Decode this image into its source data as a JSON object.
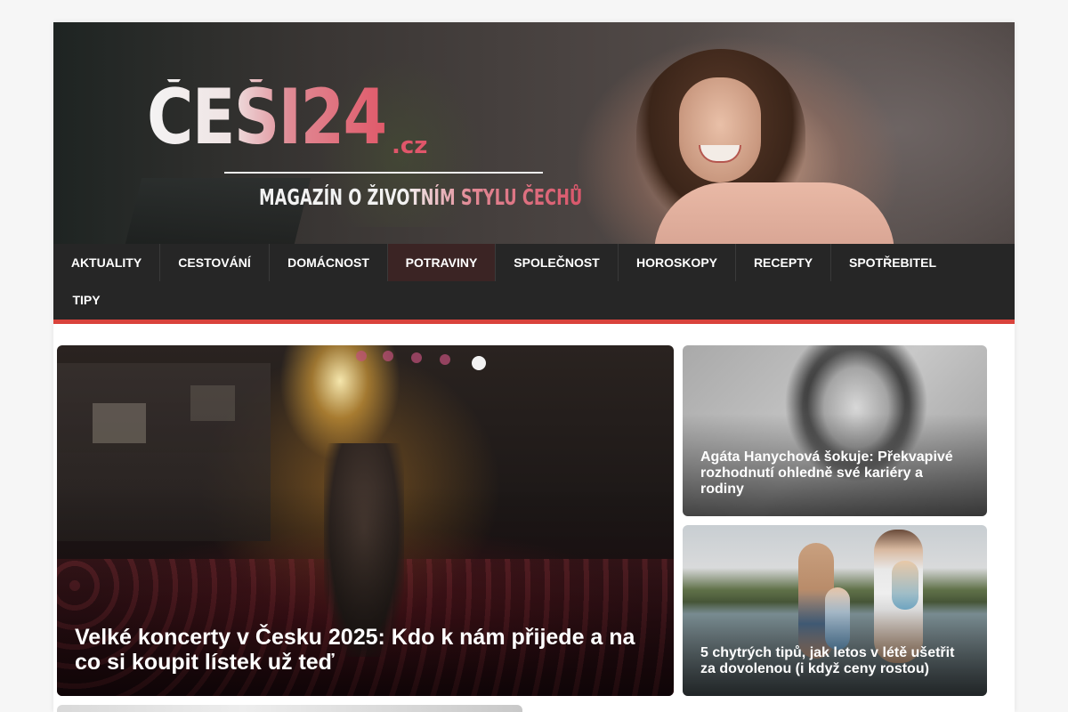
{
  "header": {
    "logo_main": "ČEŠI24",
    "logo_tld": ".cz",
    "tagline": "MAGAZÍN O ŽIVOTNÍM STYLU ČECHŮ"
  },
  "nav": {
    "items": [
      {
        "label": "AKTUALITY"
      },
      {
        "label": "CESTOVÁNÍ"
      },
      {
        "label": "DOMÁCNOST"
      },
      {
        "label": "POTRAVINY"
      },
      {
        "label": "SPOLEČNOST"
      },
      {
        "label": "HOROSKOPY"
      },
      {
        "label": "RECEPTY"
      },
      {
        "label": "SPOTŘEBITEL"
      },
      {
        "label": "TIPY"
      }
    ],
    "active": "POTRAVINY",
    "accent_color": "#d9433c"
  },
  "articles": {
    "featured": {
      "title": "Velké koncerty v Česku 2025: Kdo k nám přijede a na co si koupit lístek už teď"
    },
    "side": [
      {
        "title": "Agáta Hanychová šokuje: Překvapivé rozhodnutí ohledně své kariéry a rodiny"
      },
      {
        "title": "5 chytrých tipů, jak letos v létě ušetřit za dovolenou (i když ceny rostou)"
      }
    ]
  }
}
